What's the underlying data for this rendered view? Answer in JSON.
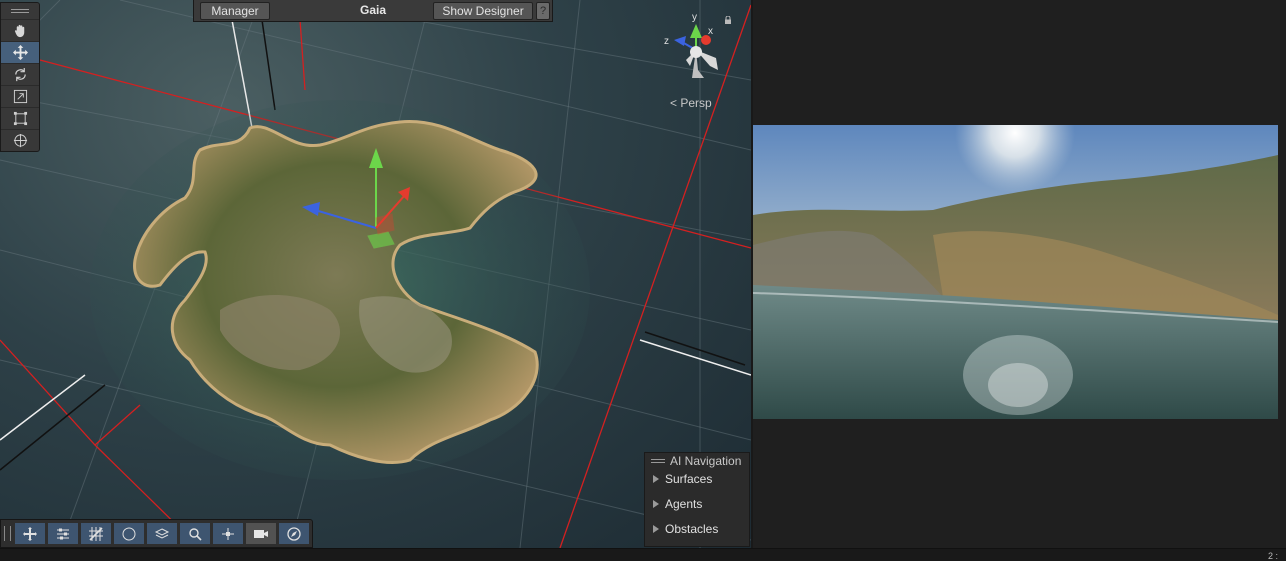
{
  "gaia": {
    "manager_label": "Manager",
    "title": "Gaia",
    "show_designer_label": "Show Designer",
    "help_label": "?"
  },
  "scene": {
    "camera_mode": "Persp",
    "axes": {
      "x": "x",
      "y": "y",
      "z": "z"
    },
    "tools": [
      {
        "name": "hand-tool",
        "icon": "hand-icon",
        "active": false
      },
      {
        "name": "move-tool",
        "icon": "move-icon",
        "active": true
      },
      {
        "name": "rotate-tool",
        "icon": "rotate-icon",
        "active": false
      },
      {
        "name": "scale-tool",
        "icon": "scale-icon",
        "active": false
      },
      {
        "name": "rect-tool",
        "icon": "rect-transform-icon",
        "active": false
      },
      {
        "name": "transform-tool",
        "icon": "transform-icon",
        "active": false
      }
    ],
    "bottom_tools": [
      "move-snap-icon",
      "settings-sliders-icon",
      "grid-snap-icon",
      "shading-icon",
      "layers-icon",
      "zoom-icon",
      "pivot-icon",
      "camera-icon",
      "compass-icon"
    ]
  },
  "ai_navigation": {
    "title": "AI Navigation",
    "items": [
      "Surfaces",
      "Agents",
      "Obstacles"
    ]
  },
  "status": {
    "text": "2 :"
  },
  "colors": {
    "accent": "#46607c",
    "axis_x": "#e53b2e",
    "axis_y": "#6cd64a",
    "axis_z": "#3b63e0"
  }
}
